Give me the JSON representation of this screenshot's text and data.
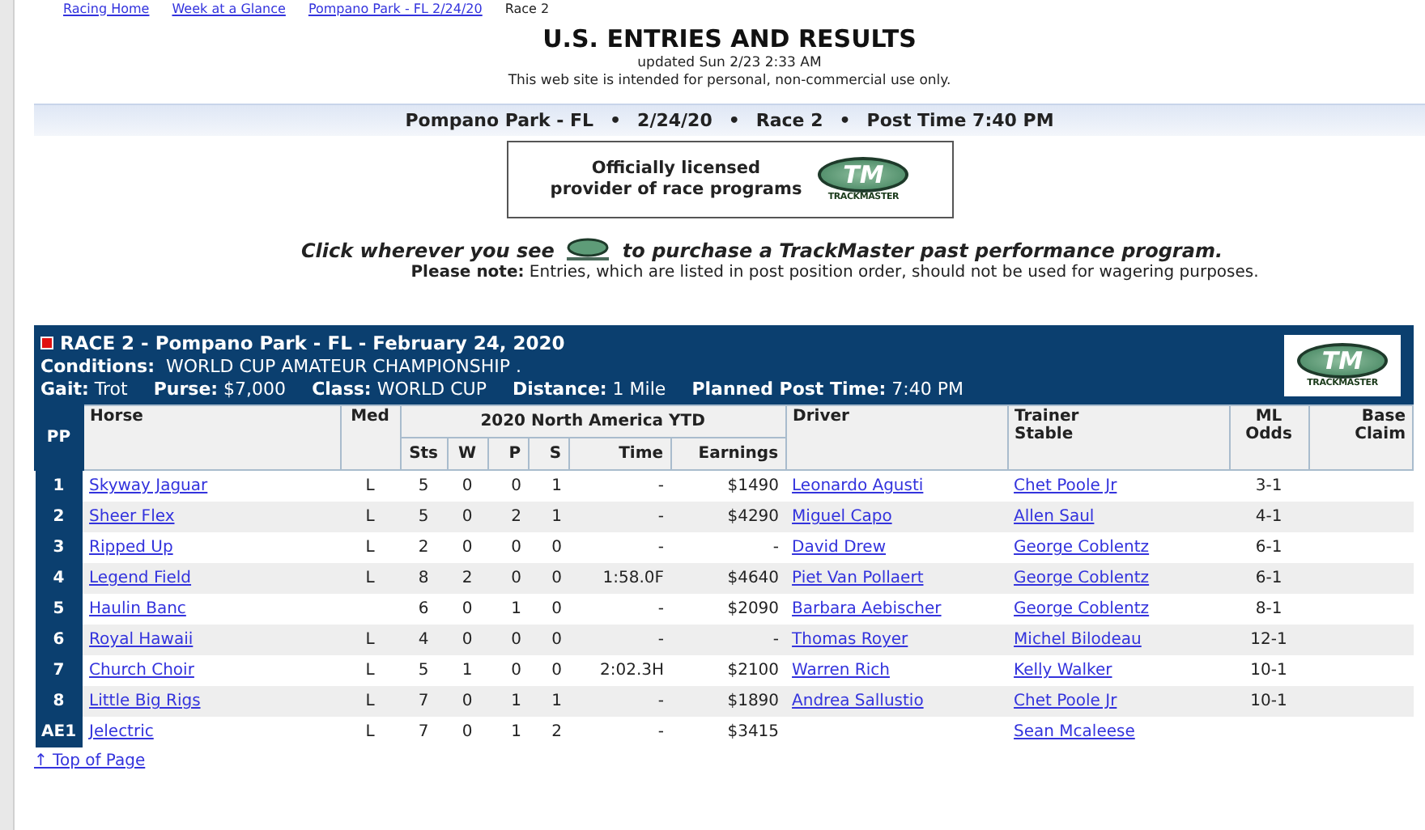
{
  "breadcrumbs": [
    "Racing Home",
    "Week at a Glance",
    "Pompano Park - FL 2/24/20",
    "Race 2"
  ],
  "title": "U.S. ENTRIES AND RESULTS",
  "updated": "updated Sun 2/23 2:33 AM",
  "notice": "This web site is intended for personal, non-commercial use only.",
  "race_bar": {
    "parts": [
      "Pompano Park - FL",
      "2/24/20",
      "Race 2",
      "Post Time 7:40 PM"
    ],
    "separator": "•"
  },
  "banner": {
    "lines": [
      "Officially licensed",
      "provider of race programs"
    ],
    "logo_mark": "TM",
    "logo_wordmark": "TRACKMASTER"
  },
  "purchase_line": {
    "before": "Click wherever you see",
    "after": "to purchase a TrackMaster past performance program."
  },
  "note": "**Please note:** Entries, which are listed in post position order, should not be used for wagering purposes.",
  "race": {
    "title": "RACE 2 - Pompano Park - FL - February 24, 2020",
    "conditions": "**Conditions:**  WORLD CUP AMATEUR CHAMPIONSHIP .",
    "details": [
      "**Gait:** Trot",
      "**Purse:** $7,000",
      "**Class:** WORLD CUP",
      "**Distance:** 1 Mile",
      "**Planned Post Time:** 7:40 PM"
    ],
    "logo_mark": "TM",
    "logo_wordmark": "TRACKMASTER"
  },
  "table": {
    "columns": {
      "pp": "PP",
      "horse": "Horse",
      "med": "Med",
      "ytd": "2020 North America YTD",
      "sts": "Sts",
      "w": "W",
      "p": "P",
      "s": "S",
      "time": "Time",
      "earnings": "Earnings",
      "driver": "Driver",
      "trainer": "Trainer",
      "stable": "Stable",
      "ml": "ML",
      "odds": "Odds",
      "base": "Base",
      "claim": "Claim"
    },
    "rows": [
      {
        "pp": "1",
        "horse": "Skyway Jaguar",
        "med": "L",
        "sts": "5",
        "w": "0",
        "p": "0",
        "s": "1",
        "time": "-",
        "earnings": "$1490",
        "driver": "Leonardo Agusti",
        "trainer": "Chet Poole Jr",
        "odds": "3-1"
      },
      {
        "pp": "2",
        "horse": "Sheer Flex",
        "med": "L",
        "sts": "5",
        "w": "0",
        "p": "2",
        "s": "1",
        "time": "-",
        "earnings": "$4290",
        "driver": "Miguel Capo",
        "trainer": "Allen Saul",
        "odds": "4-1"
      },
      {
        "pp": "3",
        "horse": "Ripped Up",
        "med": "L",
        "sts": "2",
        "w": "0",
        "p": "0",
        "s": "0",
        "time": "-",
        "earnings": "-",
        "driver": "David Drew",
        "trainer": "George Coblentz",
        "odds": "6-1"
      },
      {
        "pp": "4",
        "horse": "Legend Field",
        "med": "L",
        "sts": "8",
        "w": "2",
        "p": "0",
        "s": "0",
        "time": "1:58.0F",
        "earnings": "$4640",
        "driver": "Piet Van Pollaert",
        "trainer": "George Coblentz",
        "odds": "6-1"
      },
      {
        "pp": "5",
        "horse": "Haulin Banc",
        "sts": "6",
        "w": "0",
        "p": "1",
        "s": "0",
        "time": "-",
        "earnings": "$2090",
        "driver": "Barbara Aebischer",
        "trainer": "George Coblentz",
        "odds": "8-1"
      },
      {
        "pp": "6",
        "horse": "Royal Hawaii",
        "med": "L",
        "sts": "4",
        "w": "0",
        "p": "0",
        "s": "0",
        "time": "-",
        "earnings": "-",
        "driver": "Thomas Royer",
        "trainer": "Michel Bilodeau",
        "odds": "12-1"
      },
      {
        "pp": "7",
        "horse": "Church Choir",
        "med": "L",
        "sts": "5",
        "w": "1",
        "p": "0",
        "s": "0",
        "time": "2:02.3H",
        "earnings": "$2100",
        "driver": "Warren Rich",
        "trainer": "Kelly Walker",
        "odds": "10-1"
      },
      {
        "pp": "8",
        "horse": "Little Big Rigs",
        "med": "L",
        "sts": "7",
        "w": "0",
        "p": "1",
        "s": "1",
        "time": "-",
        "earnings": "$1890",
        "driver": "Andrea Sallustio",
        "trainer": "Chet Poole Jr",
        "odds": "10-1"
      },
      {
        "pp": "AE1",
        "horse": "Jelectric",
        "med": "L",
        "sts": "7",
        "w": "0",
        "p": "1",
        "s": "2",
        "time": "-",
        "earnings": "$3415",
        "trainer": "Sean Mcaleese"
      }
    ]
  },
  "top_link": "↑ Top of Page"
}
